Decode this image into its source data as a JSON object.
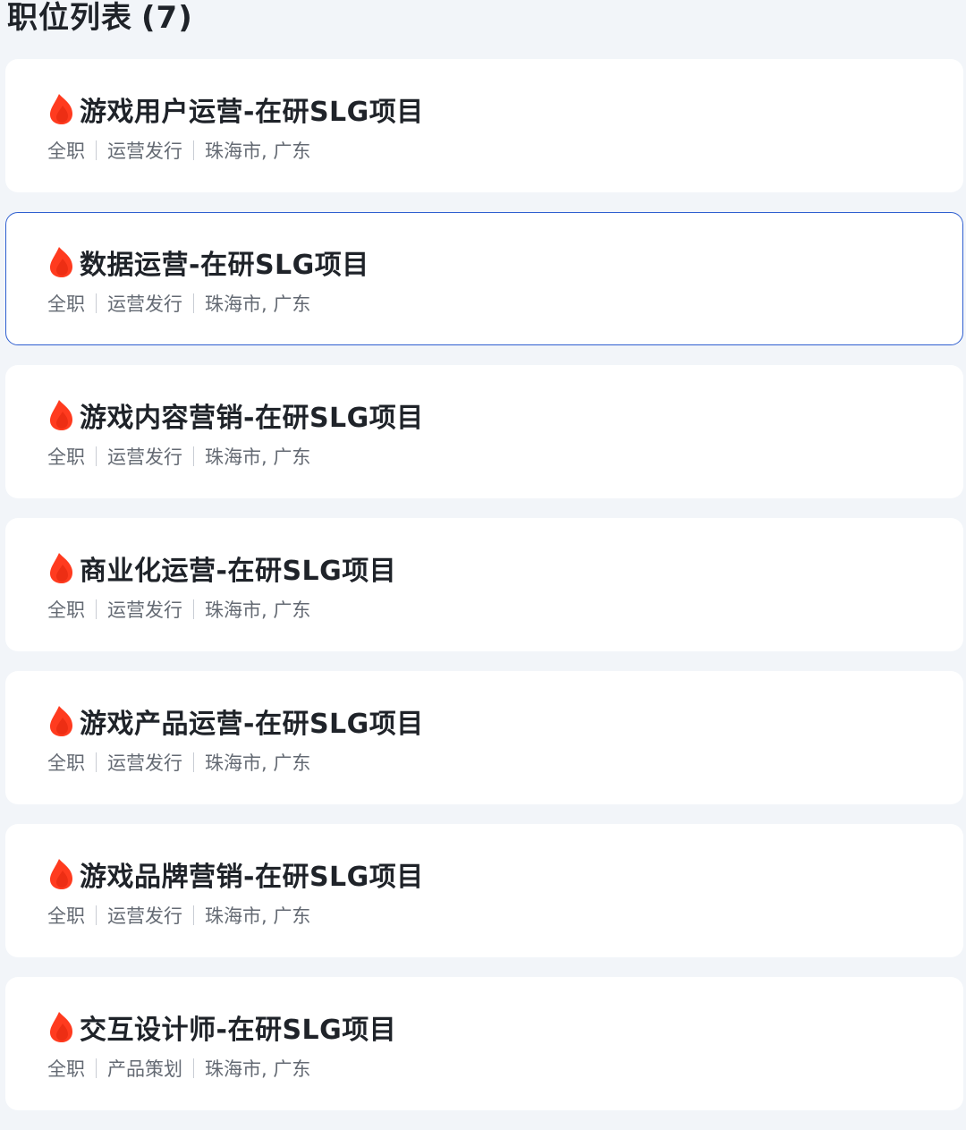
{
  "header": {
    "title": "职位列表",
    "count": "(7)"
  },
  "colors": {
    "accent": "#2f5fd0",
    "flame": "#ff3b1f",
    "background": "#f2f5f9"
  },
  "jobs": [
    {
      "icon": "fire-icon",
      "title": "游戏用户运营-在研SLG项目",
      "type": "全职",
      "category": "运营发行",
      "location": "珠海市, 广东"
    },
    {
      "icon": "fire-icon",
      "title": "数据运营-在研SLG项目",
      "type": "全职",
      "category": "运营发行",
      "location": "珠海市, 广东"
    },
    {
      "icon": "fire-icon",
      "title": "游戏内容营销-在研SLG项目",
      "type": "全职",
      "category": "运营发行",
      "location": "珠海市, 广东"
    },
    {
      "icon": "fire-icon",
      "title": "商业化运营-在研SLG项目",
      "type": "全职",
      "category": "运营发行",
      "location": "珠海市, 广东"
    },
    {
      "icon": "fire-icon",
      "title": "游戏产品运营-在研SLG项目",
      "type": "全职",
      "category": "运营发行",
      "location": "珠海市, 广东"
    },
    {
      "icon": "fire-icon",
      "title": "游戏品牌营销-在研SLG项目",
      "type": "全职",
      "category": "运营发行",
      "location": "珠海市, 广东"
    },
    {
      "icon": "fire-icon",
      "title": "交互设计师-在研SLG项目",
      "type": "全职",
      "category": "产品策划",
      "location": "珠海市, 广东"
    }
  ]
}
